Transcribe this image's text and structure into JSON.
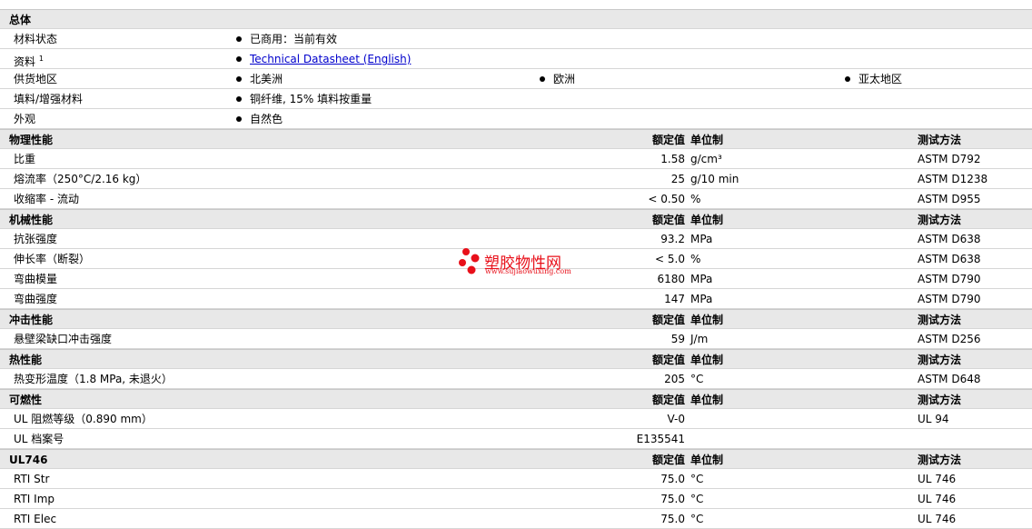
{
  "sections": {
    "general": {
      "title": "总体",
      "rows": {
        "status": {
          "label": "材料状态",
          "value": "已商用：当前有效"
        },
        "docs": {
          "label": "资料",
          "sup": "1",
          "value": "Technical Datasheet (English)"
        },
        "supply": {
          "label": "供货地区",
          "regions": [
            "北美洲",
            "欧洲",
            "亚太地区"
          ]
        },
        "filler": {
          "label": "填料/增强材料",
          "value": "铜纤维, 15% 填料按重量"
        },
        "appearance": {
          "label": "外观",
          "value": "自然色"
        }
      }
    },
    "physical": {
      "title": "物理性能",
      "h_val": "额定值",
      "h_unit": "单位制",
      "h_method": "测试方法",
      "rows": [
        {
          "label": "比重",
          "value": "1.58",
          "unit": "g/cm³",
          "method": "ASTM D792"
        },
        {
          "label": "熔流率（250°C/2.16 kg）",
          "value": "25",
          "unit": "g/10 min",
          "method": "ASTM D1238"
        },
        {
          "label": "收缩率 - 流动",
          "value": "< 0.50",
          "unit": "%",
          "method": "ASTM D955"
        }
      ]
    },
    "mechanical": {
      "title": "机械性能",
      "h_val": "额定值",
      "h_unit": "单位制",
      "h_method": "测试方法",
      "rows": [
        {
          "label": "抗张强度",
          "value": "93.2",
          "unit": "MPa",
          "method": "ASTM D638"
        },
        {
          "label": "伸长率（断裂）",
          "value": "< 5.0",
          "unit": "%",
          "method": "ASTM D638"
        },
        {
          "label": "弯曲模量",
          "value": "6180",
          "unit": "MPa",
          "method": "ASTM D790"
        },
        {
          "label": "弯曲强度",
          "value": "147",
          "unit": "MPa",
          "method": "ASTM D790"
        }
      ]
    },
    "impact": {
      "title": "冲击性能",
      "h_val": "额定值",
      "h_unit": "单位制",
      "h_method": "测试方法",
      "rows": [
        {
          "label": "悬壁梁缺口冲击强度",
          "value": "59",
          "unit": "J/m",
          "method": "ASTM D256"
        }
      ]
    },
    "thermal": {
      "title": "热性能",
      "h_val": "额定值",
      "h_unit": "单位制",
      "h_method": "测试方法",
      "rows": [
        {
          "label": "热变形温度（1.8 MPa, 未退火）",
          "value": "205",
          "unit": "°C",
          "method": "ASTM D648"
        }
      ]
    },
    "flammability": {
      "title": "可燃性",
      "h_val": "额定值",
      "h_unit": "单位制",
      "h_method": "测试方法",
      "rows": [
        {
          "label": "UL 阻燃等级（0.890 mm）",
          "value": "V-0",
          "unit": "",
          "method": "UL 94"
        },
        {
          "label": "UL 档案号",
          "value": "E135541",
          "unit": "",
          "method": ""
        }
      ]
    },
    "ul746": {
      "title": "UL746",
      "h_val": "额定值",
      "h_unit": "单位制",
      "h_method": "测试方法",
      "rows": [
        {
          "label": "RTI Str",
          "value": "75.0",
          "unit": "°C",
          "method": "UL 746"
        },
        {
          "label": "RTI Imp",
          "value": "75.0",
          "unit": "°C",
          "method": "UL 746"
        },
        {
          "label": "RTI Elec",
          "value": "75.0",
          "unit": "°C",
          "method": "UL 746"
        }
      ]
    }
  },
  "watermark": {
    "text": "塑胶物性网",
    "url": "www.sujiaowuxing.com",
    "color": "#e8101a"
  }
}
